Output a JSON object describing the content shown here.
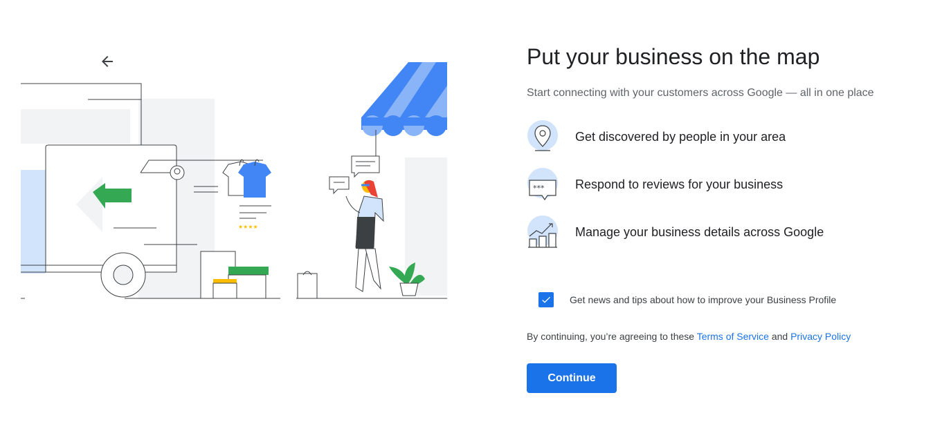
{
  "header": {
    "back_icon": "arrow-left-icon"
  },
  "main": {
    "title": "Put your business on the map",
    "subtitle": "Start connecting with your customers across Google — all in one place",
    "features": [
      {
        "icon": "map-pin-icon",
        "label": "Get discovered by people in your area"
      },
      {
        "icon": "review-bubble-icon",
        "label": "Respond to reviews for your business"
      },
      {
        "icon": "storefront-chart-icon",
        "label": "Manage your business details across Google"
      }
    ],
    "newsletter": {
      "label": "Get news and tips about how to improve your Business Profile",
      "checked": true
    },
    "terms": {
      "prefix": "By continuing, you’re agreeing to these ",
      "tos": "Terms of Service",
      "and": " and ",
      "privacy": "Privacy Policy"
    },
    "continue_label": "Continue"
  },
  "colors": {
    "accent": "#1a73e8",
    "green": "#34a853",
    "yellow": "#fbbc04",
    "light_blue": "#d2e3fc"
  }
}
